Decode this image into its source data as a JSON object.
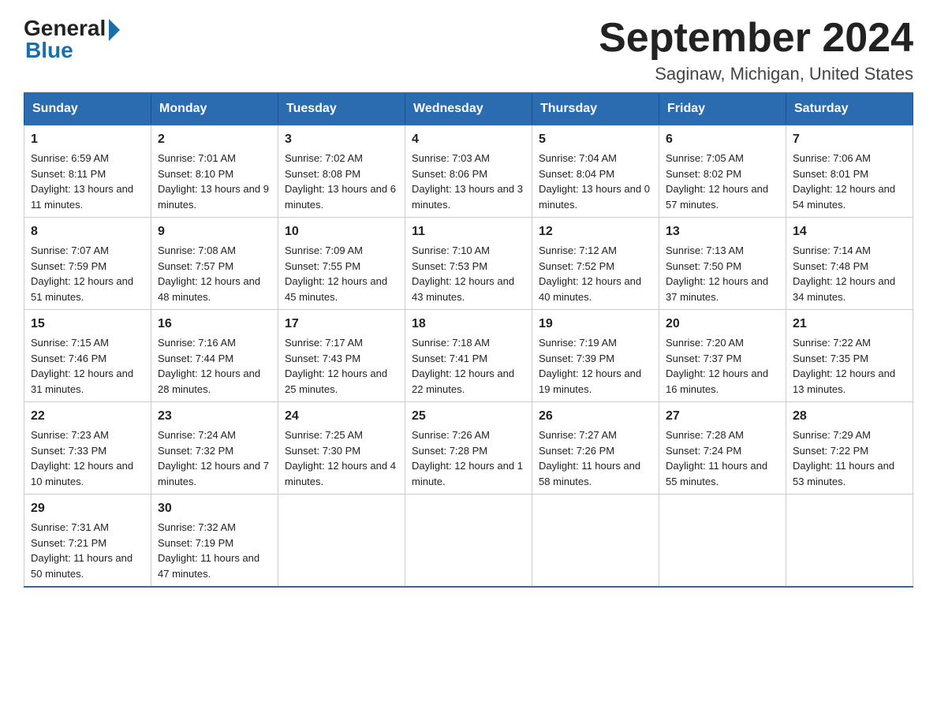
{
  "header": {
    "logo_general": "General",
    "logo_blue": "Blue",
    "month_title": "September 2024",
    "location": "Saginaw, Michigan, United States"
  },
  "weekdays": [
    "Sunday",
    "Monday",
    "Tuesday",
    "Wednesday",
    "Thursday",
    "Friday",
    "Saturday"
  ],
  "weeks": [
    [
      {
        "day": "1",
        "sunrise": "6:59 AM",
        "sunset": "8:11 PM",
        "daylight": "13 hours and 11 minutes."
      },
      {
        "day": "2",
        "sunrise": "7:01 AM",
        "sunset": "8:10 PM",
        "daylight": "13 hours and 9 minutes."
      },
      {
        "day": "3",
        "sunrise": "7:02 AM",
        "sunset": "8:08 PM",
        "daylight": "13 hours and 6 minutes."
      },
      {
        "day": "4",
        "sunrise": "7:03 AM",
        "sunset": "8:06 PM",
        "daylight": "13 hours and 3 minutes."
      },
      {
        "day": "5",
        "sunrise": "7:04 AM",
        "sunset": "8:04 PM",
        "daylight": "13 hours and 0 minutes."
      },
      {
        "day": "6",
        "sunrise": "7:05 AM",
        "sunset": "8:02 PM",
        "daylight": "12 hours and 57 minutes."
      },
      {
        "day": "7",
        "sunrise": "7:06 AM",
        "sunset": "8:01 PM",
        "daylight": "12 hours and 54 minutes."
      }
    ],
    [
      {
        "day": "8",
        "sunrise": "7:07 AM",
        "sunset": "7:59 PM",
        "daylight": "12 hours and 51 minutes."
      },
      {
        "day": "9",
        "sunrise": "7:08 AM",
        "sunset": "7:57 PM",
        "daylight": "12 hours and 48 minutes."
      },
      {
        "day": "10",
        "sunrise": "7:09 AM",
        "sunset": "7:55 PM",
        "daylight": "12 hours and 45 minutes."
      },
      {
        "day": "11",
        "sunrise": "7:10 AM",
        "sunset": "7:53 PM",
        "daylight": "12 hours and 43 minutes."
      },
      {
        "day": "12",
        "sunrise": "7:12 AM",
        "sunset": "7:52 PM",
        "daylight": "12 hours and 40 minutes."
      },
      {
        "day": "13",
        "sunrise": "7:13 AM",
        "sunset": "7:50 PM",
        "daylight": "12 hours and 37 minutes."
      },
      {
        "day": "14",
        "sunrise": "7:14 AM",
        "sunset": "7:48 PM",
        "daylight": "12 hours and 34 minutes."
      }
    ],
    [
      {
        "day": "15",
        "sunrise": "7:15 AM",
        "sunset": "7:46 PM",
        "daylight": "12 hours and 31 minutes."
      },
      {
        "day": "16",
        "sunrise": "7:16 AM",
        "sunset": "7:44 PM",
        "daylight": "12 hours and 28 minutes."
      },
      {
        "day": "17",
        "sunrise": "7:17 AM",
        "sunset": "7:43 PM",
        "daylight": "12 hours and 25 minutes."
      },
      {
        "day": "18",
        "sunrise": "7:18 AM",
        "sunset": "7:41 PM",
        "daylight": "12 hours and 22 minutes."
      },
      {
        "day": "19",
        "sunrise": "7:19 AM",
        "sunset": "7:39 PM",
        "daylight": "12 hours and 19 minutes."
      },
      {
        "day": "20",
        "sunrise": "7:20 AM",
        "sunset": "7:37 PM",
        "daylight": "12 hours and 16 minutes."
      },
      {
        "day": "21",
        "sunrise": "7:22 AM",
        "sunset": "7:35 PM",
        "daylight": "12 hours and 13 minutes."
      }
    ],
    [
      {
        "day": "22",
        "sunrise": "7:23 AM",
        "sunset": "7:33 PM",
        "daylight": "12 hours and 10 minutes."
      },
      {
        "day": "23",
        "sunrise": "7:24 AM",
        "sunset": "7:32 PM",
        "daylight": "12 hours and 7 minutes."
      },
      {
        "day": "24",
        "sunrise": "7:25 AM",
        "sunset": "7:30 PM",
        "daylight": "12 hours and 4 minutes."
      },
      {
        "day": "25",
        "sunrise": "7:26 AM",
        "sunset": "7:28 PM",
        "daylight": "12 hours and 1 minute."
      },
      {
        "day": "26",
        "sunrise": "7:27 AM",
        "sunset": "7:26 PM",
        "daylight": "11 hours and 58 minutes."
      },
      {
        "day": "27",
        "sunrise": "7:28 AM",
        "sunset": "7:24 PM",
        "daylight": "11 hours and 55 minutes."
      },
      {
        "day": "28",
        "sunrise": "7:29 AM",
        "sunset": "7:22 PM",
        "daylight": "11 hours and 53 minutes."
      }
    ],
    [
      {
        "day": "29",
        "sunrise": "7:31 AM",
        "sunset": "7:21 PM",
        "daylight": "11 hours and 50 minutes."
      },
      {
        "day": "30",
        "sunrise": "7:32 AM",
        "sunset": "7:19 PM",
        "daylight": "11 hours and 47 minutes."
      },
      null,
      null,
      null,
      null,
      null
    ]
  ],
  "labels": {
    "sunrise": "Sunrise:",
    "sunset": "Sunset:",
    "daylight": "Daylight:"
  }
}
